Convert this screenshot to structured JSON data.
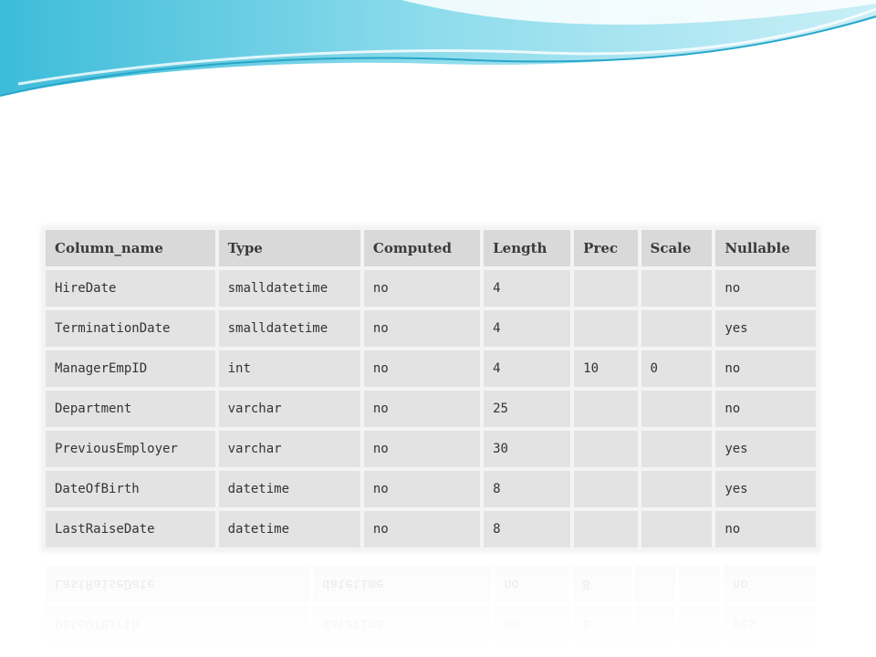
{
  "table": {
    "headers": [
      "Column_name",
      "Type",
      "Computed",
      "Length",
      "Prec",
      "Scale",
      "Nullable"
    ],
    "rows": [
      [
        "HireDate",
        "smalldatetime",
        "no",
        "4",
        "",
        "",
        "no"
      ],
      [
        "TerminationDate",
        "smalldatetime",
        "no",
        "4",
        "",
        "",
        "yes"
      ],
      [
        "ManagerEmpID",
        "int",
        "no",
        "4",
        "10",
        "0",
        "no"
      ],
      [
        "Department",
        "varchar",
        "no",
        "25",
        "",
        "",
        "no"
      ],
      [
        "PreviousEmployer",
        "varchar",
        "no",
        "30",
        "",
        "",
        "yes"
      ],
      [
        "DateOfBirth",
        "datetime",
        "no",
        "8",
        "",
        "",
        "yes"
      ],
      [
        "LastRaiseDate",
        "datetime",
        "no",
        "8",
        "",
        "",
        "no"
      ]
    ]
  },
  "colors": {
    "wave_light": "#d6f3f8",
    "wave_mid": "#8fdbea",
    "wave_dark": "#39b6d6"
  }
}
